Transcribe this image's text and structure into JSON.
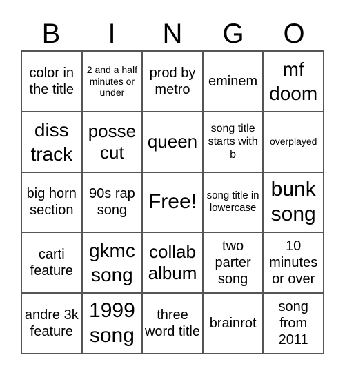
{
  "header": [
    "B",
    "I",
    "N",
    "G",
    "O"
  ],
  "cells": [
    "color in the title",
    "2 and a half minutes or under",
    "prod by metro",
    "eminem",
    "mf doom",
    "diss track",
    "posse cut",
    "queen",
    "song title starts with b",
    "overplayed",
    "big horn section",
    "90s rap song",
    "Free!",
    "song title in lowercase",
    "bunk song",
    "carti feature",
    "gkmc song",
    "collab album",
    "two parter song",
    "10 minutes or over",
    "andre 3k feature",
    "1999 song",
    "three word title",
    "brainrot",
    "song from 2011"
  ]
}
